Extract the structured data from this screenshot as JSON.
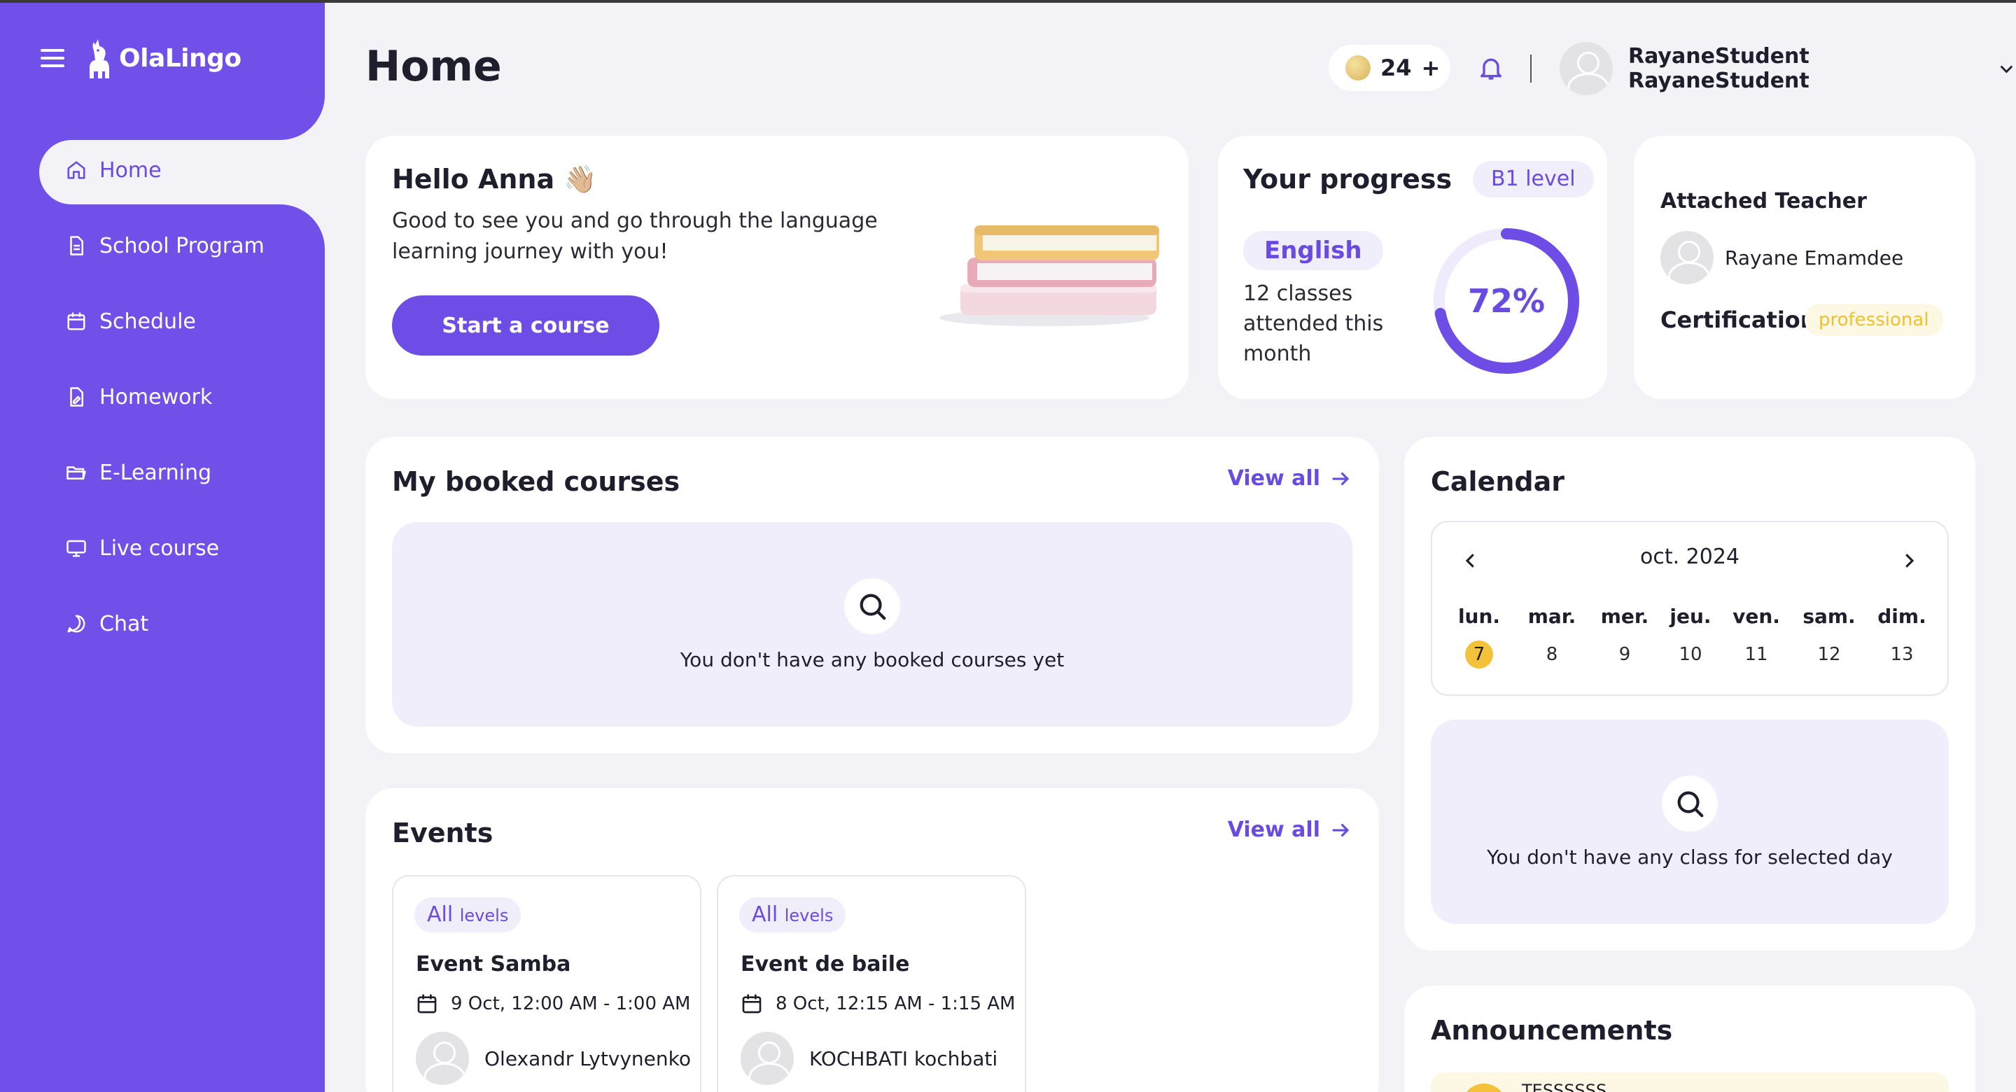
{
  "app": {
    "name": "OlaLingo"
  },
  "sidebar": {
    "items": [
      {
        "label": "Home"
      },
      {
        "label": "School Program"
      },
      {
        "label": "Schedule"
      },
      {
        "label": "Homework"
      },
      {
        "label": "E-Learning"
      },
      {
        "label": "Live course"
      },
      {
        "label": "Chat"
      }
    ]
  },
  "header": {
    "title": "Home",
    "coins": "24",
    "coins_add": "+",
    "user_name": "RayaneStudent RayaneStudent"
  },
  "hello": {
    "title": "Hello Anna 👋🏼",
    "text": "Good to see you and go through the language learning journey with you!",
    "button": "Start a course"
  },
  "progress": {
    "title": "Your progress",
    "level": "B1 level",
    "language": "English",
    "classes_text": "12 classes attended this month",
    "percent_label": "72%",
    "percent_value": 0.72
  },
  "teacher": {
    "title": "Attached Teacher",
    "name": "Rayane Emamdee",
    "cert_label": "Certification:",
    "cert_value": "professional"
  },
  "booked": {
    "title": "My booked courses",
    "view_all": "View all",
    "empty": "You don't have any booked courses yet"
  },
  "calendar": {
    "title": "Calendar",
    "month": "oct. 2024",
    "days": [
      {
        "name": "lun.",
        "date": "7",
        "today": true
      },
      {
        "name": "mar.",
        "date": "8"
      },
      {
        "name": "mer.",
        "date": "9"
      },
      {
        "name": "jeu.",
        "date": "10"
      },
      {
        "name": "ven.",
        "date": "11"
      },
      {
        "name": "sam.",
        "date": "12"
      },
      {
        "name": "dim.",
        "date": "13"
      }
    ],
    "empty": "You don't have any class for selected day"
  },
  "events": {
    "title": "Events",
    "view_all": "View all",
    "items": [
      {
        "badge_main": "All",
        "badge_sub": "levels",
        "title": "Event Samba",
        "date": "9 Oct, 12:00 AM - 1:00 AM",
        "host": "Olexandr Lytvynenko"
      },
      {
        "badge_main": "All",
        "badge_sub": "levels",
        "title": "Event de baile",
        "date": "8 Oct, 12:15 AM - 1:15 AM",
        "host": "KOCHBATI kochbati"
      }
    ]
  },
  "announcements": {
    "title": "Announcements",
    "first_item": "TESSSSSS"
  },
  "colors": {
    "primary": "#7050E8",
    "accent_text": "#6A4BE0",
    "soft_purple": "#F1EEFC",
    "today_yellow": "#F4C23A",
    "background": "#F2F2F7"
  }
}
